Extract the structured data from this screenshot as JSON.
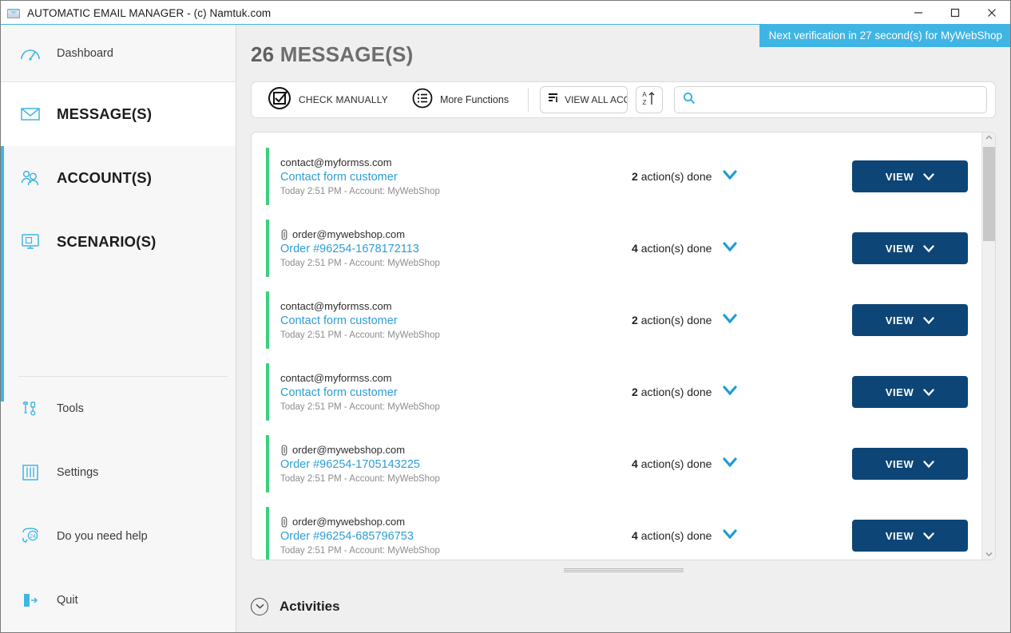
{
  "window": {
    "title": "AUTOMATIC EMAIL MANAGER - (c) Namtuk.com",
    "app_icon": "envelope-printer-icon",
    "minimize_label": "—",
    "maximize_label": "☐",
    "close_label": "✕"
  },
  "sidebar": {
    "dashboard": {
      "label": "Dashboard",
      "icon": "gauge-icon"
    },
    "items": [
      {
        "label": "MESSAGE(S)",
        "icon": "envelope-icon",
        "active": true
      },
      {
        "label": "ACCOUNT(S)",
        "icon": "users-icon",
        "active": false
      },
      {
        "label": "SCENARIO(S)",
        "icon": "monitor-script-icon",
        "active": false
      }
    ],
    "bottom_items": [
      {
        "label": "Tools",
        "icon": "tools-icon"
      },
      {
        "label": "Settings",
        "icon": "sliders-icon"
      },
      {
        "label": "Do you need help",
        "icon": "support-24-icon"
      },
      {
        "label": "Quit",
        "icon": "exit-door-icon"
      }
    ]
  },
  "notification": {
    "text": "Next verification in 27 second(s) for MyWebShop",
    "color": "#3fb5e4"
  },
  "header": {
    "count": "26",
    "title": "MESSAGE(S)"
  },
  "toolbar": {
    "check_manually_label": "CHECK MANUALLY",
    "check_manually_icon": "circle-checkbox-icon",
    "more_functions_label": "More Functions",
    "more_functions_icon": "circle-list-icon",
    "view_all_accounts_label": "VIEW ALL ACCO",
    "view_all_accounts_icon": "filter-list-icon",
    "sort_icon": "sort-az-ascending-icon",
    "search_icon": "search-icon",
    "search_value": "",
    "search_placeholder": ""
  },
  "messages": [
    {
      "from": "contact@myformss.com",
      "has_attachment": false,
      "subject": "Contact form customer",
      "meta": "Today 2:51 PM - Account: MyWebShop",
      "actions_count": "2",
      "actions_text": "action(s) done",
      "view_label": "VIEW",
      "accent_color": "#3ad07f"
    },
    {
      "from": "order@mywebshop.com",
      "has_attachment": true,
      "subject": "Order #96254-1678172113",
      "meta": "Today 2:51 PM - Account: MyWebShop",
      "actions_count": "4",
      "actions_text": "action(s) done",
      "view_label": "VIEW",
      "accent_color": "#3ad07f"
    },
    {
      "from": "contact@myformss.com",
      "has_attachment": false,
      "subject": "Contact form customer",
      "meta": "Today 2:51 PM - Account: MyWebShop",
      "actions_count": "2",
      "actions_text": "action(s) done",
      "view_label": "VIEW",
      "accent_color": "#3ad07f"
    },
    {
      "from": "contact@myformss.com",
      "has_attachment": false,
      "subject": "Contact form customer",
      "meta": "Today 2:51 PM - Account: MyWebShop",
      "actions_count": "2",
      "actions_text": "action(s) done",
      "view_label": "VIEW",
      "accent_color": "#3ad07f"
    },
    {
      "from": "order@mywebshop.com",
      "has_attachment": true,
      "subject": "Order #96254-1705143225",
      "meta": "Today 2:51 PM - Account: MyWebShop",
      "actions_count": "4",
      "actions_text": "action(s) done",
      "view_label": "VIEW",
      "accent_color": "#3ad07f"
    },
    {
      "from": "order@mywebshop.com",
      "has_attachment": true,
      "subject": "Order #96254-685796753",
      "meta": "Today 2:51 PM - Account: MyWebShop",
      "actions_count": "4",
      "actions_text": "action(s) done",
      "view_label": "VIEW",
      "accent_color": "#3ad07f"
    }
  ],
  "footer": {
    "activities_label": "Activities",
    "activities_icon": "chevron-down-circle-icon"
  }
}
